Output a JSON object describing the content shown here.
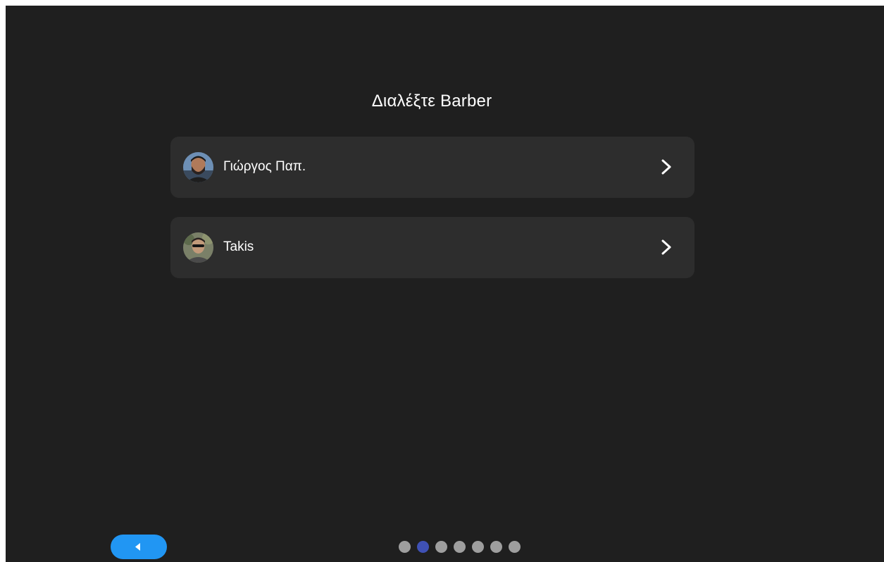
{
  "page": {
    "title": "Διαλέξτε Barber"
  },
  "barbers": [
    {
      "name": "Γιώργος Παπ.",
      "avatar_icon": "person-photo-icon"
    },
    {
      "name": "Takis",
      "avatar_icon": "person-photo-icon"
    }
  ],
  "navigation": {
    "back_icon": "caret-left-icon",
    "steps_total": 7,
    "active_step": 2
  },
  "colors": {
    "background": "#1f1f1f",
    "card": "#2d2d2d",
    "accent": "#2196f3",
    "active_dot": "#3f51b5",
    "inactive_dot": "#9e9e9e"
  }
}
